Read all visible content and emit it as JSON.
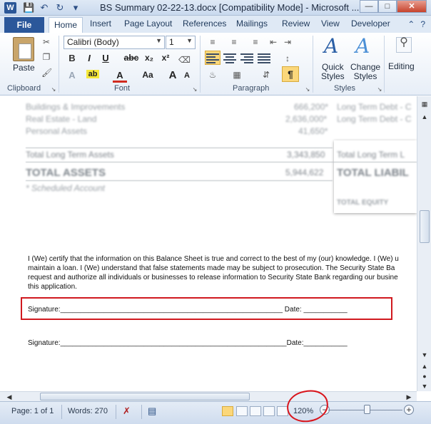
{
  "titlebar": {
    "app_icon": "W",
    "title": "BS Summary 02-22-13.docx [Compatibility Mode]  -  Microsoft ..."
  },
  "tabs": {
    "file": "File",
    "items": [
      "Home",
      "Insert",
      "Page Layout",
      "References",
      "Mailings",
      "Review",
      "View",
      "Developer"
    ]
  },
  "ribbon": {
    "paste_label": "Paste",
    "font_name": "Calibri (Body)",
    "font_size": "1",
    "clipboard_label": "Clipboard",
    "font_label": "Font",
    "paragraph_label": "Paragraph",
    "styles_label": "Styles",
    "quick_styles_line1": "Quick",
    "quick_styles_line2": "Styles",
    "change_styles_line1": "Change",
    "change_styles_line2": "Styles",
    "editing_label": "Editing",
    "bold": "B",
    "italic": "I",
    "underline": "U",
    "strike": "abc",
    "subscript": "x₂",
    "superscript": "x²",
    "grow_font": "A",
    "shrink_font": "A",
    "change_case": "Aa",
    "highlight": "ab",
    "font_color": "A",
    "pilcrow": "¶"
  },
  "document": {
    "blurred_rows_left": [
      {
        "label": "Buildings & Improvements",
        "value": "666,200*"
      },
      {
        "label": "Real Estate - Land",
        "value": "2,636,000*"
      },
      {
        "label": "Personal Assets",
        "value": "41,650*"
      }
    ],
    "blurred_right_labels": [
      "Long Term Debt - C",
      "Long Term Debt - C"
    ],
    "total_long_term_assets": {
      "label": "Total Long Term Assets",
      "value": "3,343,850",
      "right": "Total Long Term L"
    },
    "total_assets": {
      "label": "TOTAL ASSETS",
      "value": "5,944,622",
      "right": "TOTAL LIABIL"
    },
    "scheduled_account": "* Scheduled Account",
    "total_equity": "TOTAL EQUITY",
    "certification_lines": [
      "I (We) certify that the information on this Balance Sheet is true and correct to the best of my (our) knowledge.  I (We) u",
      "maintain a loan.  I (We) understand that false statements made may be subject to prosecution. The Security State Ba",
      "request and authorize all individuals or businesses to release information to Security State Bank regarding our busine",
      "this application."
    ],
    "signature_line_1": "Signature:________________________________________________________  Date: ___________",
    "signature_line_2": "Signature:_________________________________________________________Date:___________"
  },
  "statusbar": {
    "page": "Page: 1 of 1",
    "words": "Words: 270",
    "zoom": "120%",
    "zoom_out": "−",
    "zoom_in": "+"
  },
  "colors": {
    "file_tab": "#2b579a",
    "highlight_box": "#d0191f",
    "active_button": "#fbd77a"
  }
}
